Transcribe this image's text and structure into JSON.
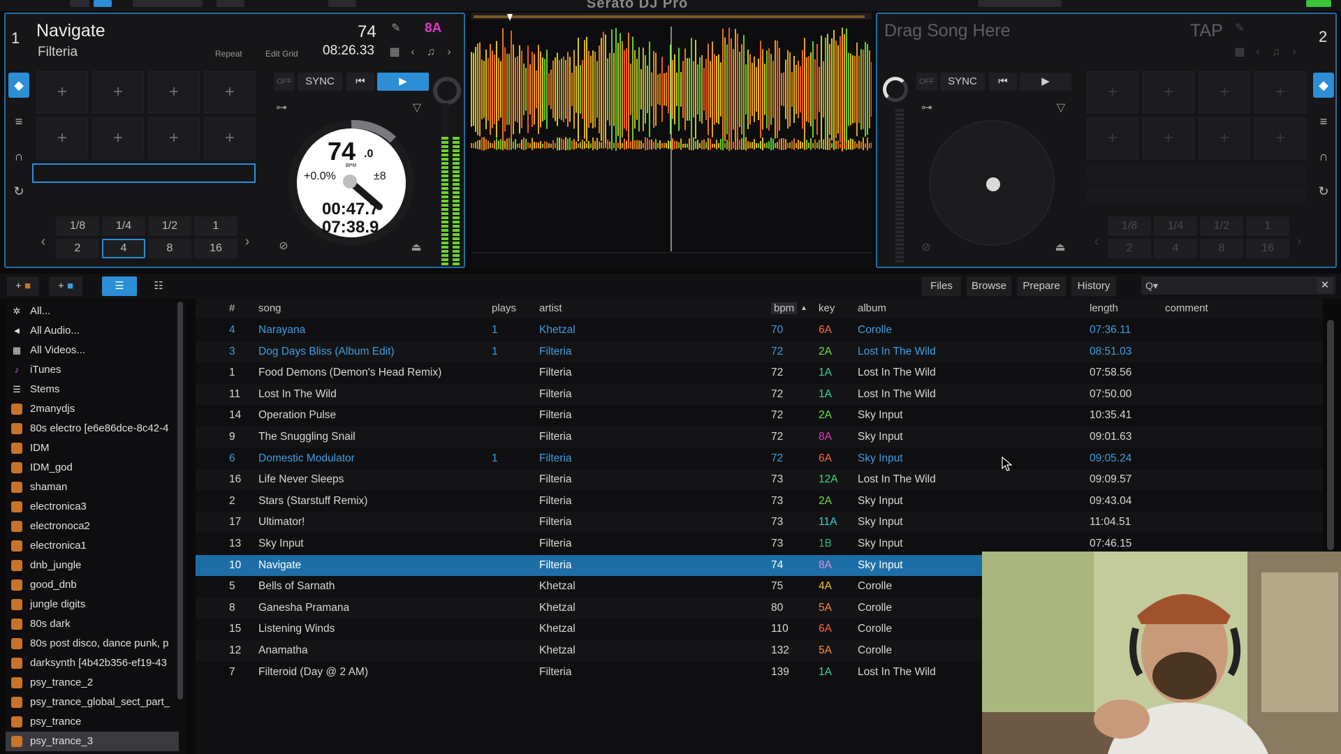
{
  "app": {
    "logo": "Serato DJ Pro"
  },
  "deck1": {
    "number": "1",
    "title": "Navigate",
    "artist": "Filteria",
    "bpm": "74",
    "key": "8A",
    "key_color": "#e03cc8",
    "repeat_label": "Repeat",
    "edit_grid_label": "Edit Grid",
    "time_remaining": "08:26.33",
    "sync_label": "SYNC",
    "off_label": "OFF",
    "platter_bpm": "74",
    "platter_bpm_dec": ".0",
    "platter_bpm_unit": "BPM",
    "pitch": "+0.0%",
    "range": "±8",
    "elapsed": "00:47.7",
    "remain": "07:38.9",
    "loop_row1": [
      "1/8",
      "1/4",
      "1/2",
      "1"
    ],
    "loop_row2": [
      "2",
      "4",
      "8",
      "16"
    ],
    "loop_active": "4"
  },
  "deck2": {
    "number": "2",
    "placeholder": "Drag Song Here",
    "tap_label": "TAP",
    "sync_label": "SYNC",
    "off_label": "OFF",
    "loop_row1": [
      "1/8",
      "1/4",
      "1/2",
      "1"
    ],
    "loop_row2": [
      "2",
      "4",
      "8",
      "16"
    ]
  },
  "library_toolbar": {
    "files": "Files",
    "browse": "Browse",
    "prepare": "Prepare",
    "history": "History",
    "search_placeholder": "Q▾"
  },
  "sidebar": {
    "items": [
      {
        "label": "All...",
        "icon": "gear-icon"
      },
      {
        "label": "All Audio...",
        "icon": "speaker-icon"
      },
      {
        "label": "All Videos...",
        "icon": "film-icon"
      },
      {
        "label": "iTunes",
        "icon": "itunes-icon"
      },
      {
        "label": "Stems",
        "icon": "stems-icon"
      },
      {
        "label": "2manydjs",
        "icon": "crate-icon"
      },
      {
        "label": "80s electro [e6e86dce-8c42-4",
        "icon": "crate-icon"
      },
      {
        "label": "IDM",
        "icon": "crate-icon"
      },
      {
        "label": "IDM_god",
        "icon": "crate-icon"
      },
      {
        "label": "shaman",
        "icon": "crate-icon"
      },
      {
        "label": "electronica3",
        "icon": "crate-icon"
      },
      {
        "label": "electronoca2",
        "icon": "crate-icon"
      },
      {
        "label": "electronica1",
        "icon": "crate-icon"
      },
      {
        "label": "dnb_jungle",
        "icon": "crate-icon"
      },
      {
        "label": "good_dnb",
        "icon": "crate-icon"
      },
      {
        "label": "jungle digits",
        "icon": "crate-icon"
      },
      {
        "label": "80s dark",
        "icon": "crate-icon"
      },
      {
        "label": "80s post disco, dance punk, p",
        "icon": "crate-icon"
      },
      {
        "label": "darksynth [4b42b356-ef19-43",
        "icon": "crate-icon"
      },
      {
        "label": "psy_trance_2",
        "icon": "crate-icon"
      },
      {
        "label": "psy_trance_global_sect_part_",
        "icon": "crate-icon"
      },
      {
        "label": "psy_trance",
        "icon": "crate-icon"
      },
      {
        "label": "psy_trance_3",
        "icon": "crate-icon"
      }
    ],
    "selected_index": 22
  },
  "table": {
    "headers": {
      "num": "#",
      "song": "song",
      "plays": "plays",
      "artist": "artist",
      "bpm": "bpm",
      "key": "key",
      "album": "album",
      "length": "length",
      "comment": "comment"
    },
    "rows": [
      {
        "num": "4",
        "song": "Narayana",
        "plays": "1",
        "artist": "Khetzal",
        "bpm": "70",
        "key": "6A",
        "key_color": "#ff6a3d",
        "album": "Corolle",
        "length": "07:36.11",
        "played": true
      },
      {
        "num": "3",
        "song": "Dog Days Bliss (Album Edit)",
        "plays": "1",
        "artist": "Filteria",
        "bpm": "72",
        "key": "2A",
        "key_color": "#6fe13a",
        "album": "Lost In The Wild",
        "length": "08:51.03",
        "played": true
      },
      {
        "num": "1",
        "song": "Food Demons (Demon's Head Remix)",
        "plays": "",
        "artist": "Filteria",
        "bpm": "72",
        "key": "1A",
        "key_color": "#2fd9a0",
        "album": "Lost In The Wild",
        "length": "07:58.56",
        "played": false
      },
      {
        "num": "11",
        "song": "Lost In The Wild",
        "plays": "",
        "artist": "Filteria",
        "bpm": "72",
        "key": "1A",
        "key_color": "#2fd9a0",
        "album": "Lost In The Wild",
        "length": "07:50.00",
        "played": false
      },
      {
        "num": "14",
        "song": "Operation Pulse",
        "plays": "",
        "artist": "Filteria",
        "bpm": "72",
        "key": "2A",
        "key_color": "#6fe13a",
        "album": "Sky Input",
        "length": "10:35.41",
        "played": false
      },
      {
        "num": "9",
        "song": "The Snuggling Snail",
        "plays": "",
        "artist": "Filteria",
        "bpm": "72",
        "key": "8A",
        "key_color": "#e03cc8",
        "album": "Sky Input",
        "length": "09:01.63",
        "played": false
      },
      {
        "num": "6",
        "song": "Domestic Modulator",
        "plays": "1",
        "artist": "Filteria",
        "bpm": "72",
        "key": "6A",
        "key_color": "#ff6a3d",
        "album": "Sky Input",
        "length": "09:05.24",
        "played": true
      },
      {
        "num": "16",
        "song": "Life Never Sleeps",
        "plays": "",
        "artist": "Filteria",
        "bpm": "73",
        "key": "12A",
        "key_color": "#37e07a",
        "album": "Lost In The Wild",
        "length": "09:09.57",
        "played": false
      },
      {
        "num": "2",
        "song": "Stars (Starstuff Remix)",
        "plays": "",
        "artist": "Filteria",
        "bpm": "73",
        "key": "2A",
        "key_color": "#6fe13a",
        "album": "Sky Input",
        "length": "09:43.04",
        "played": false
      },
      {
        "num": "17",
        "song": "Ultimator!",
        "plays": "",
        "artist": "Filteria",
        "bpm": "73",
        "key": "11A",
        "key_color": "#31d7d0",
        "album": "Sky Input",
        "length": "11:04.51",
        "played": false
      },
      {
        "num": "13",
        "song": "Sky Input",
        "plays": "",
        "artist": "Filteria",
        "bpm": "73",
        "key": "1B",
        "key_color": "#2fb07a",
        "album": "Sky Input",
        "length": "07:46.15",
        "played": false
      },
      {
        "num": "10",
        "song": "Navigate",
        "plays": "",
        "artist": "Filteria",
        "bpm": "74",
        "key": "8A",
        "key_color": "#e03cc8",
        "album": "Sky Input",
        "length": "",
        "played": false,
        "selected": true
      },
      {
        "num": "5",
        "song": "Bells of Sarnath",
        "plays": "",
        "artist": "Khetzal",
        "bpm": "75",
        "key": "4A",
        "key_color": "#f2c12e",
        "album": "Corolle",
        "length": "",
        "played": false
      },
      {
        "num": "8",
        "song": "Ganesha Pramana",
        "plays": "",
        "artist": "Khetzal",
        "bpm": "80",
        "key": "5A",
        "key_color": "#ff8a2e",
        "album": "Corolle",
        "length": "",
        "played": false
      },
      {
        "num": "15",
        "song": "Listening Winds",
        "plays": "",
        "artist": "Khetzal",
        "bpm": "110",
        "key": "6A",
        "key_color": "#ff6a3d",
        "album": "Corolle",
        "length": "",
        "played": false
      },
      {
        "num": "12",
        "song": "Anamatha",
        "plays": "",
        "artist": "Khetzal",
        "bpm": "132",
        "key": "5A",
        "key_color": "#ff8a2e",
        "album": "Corolle",
        "length": "",
        "played": false
      },
      {
        "num": "7",
        "song": "Filteroid (Day @ 2 AM)",
        "plays": "",
        "artist": "Filteria",
        "bpm": "139",
        "key": "1A",
        "key_color": "#2fd9a0",
        "album": "Lost In The Wild",
        "length": "",
        "played": false
      }
    ]
  },
  "colors": {
    "accent": "#2b8ed6",
    "played": "#3f9ddf",
    "selected_row": "#1d6ea6"
  }
}
